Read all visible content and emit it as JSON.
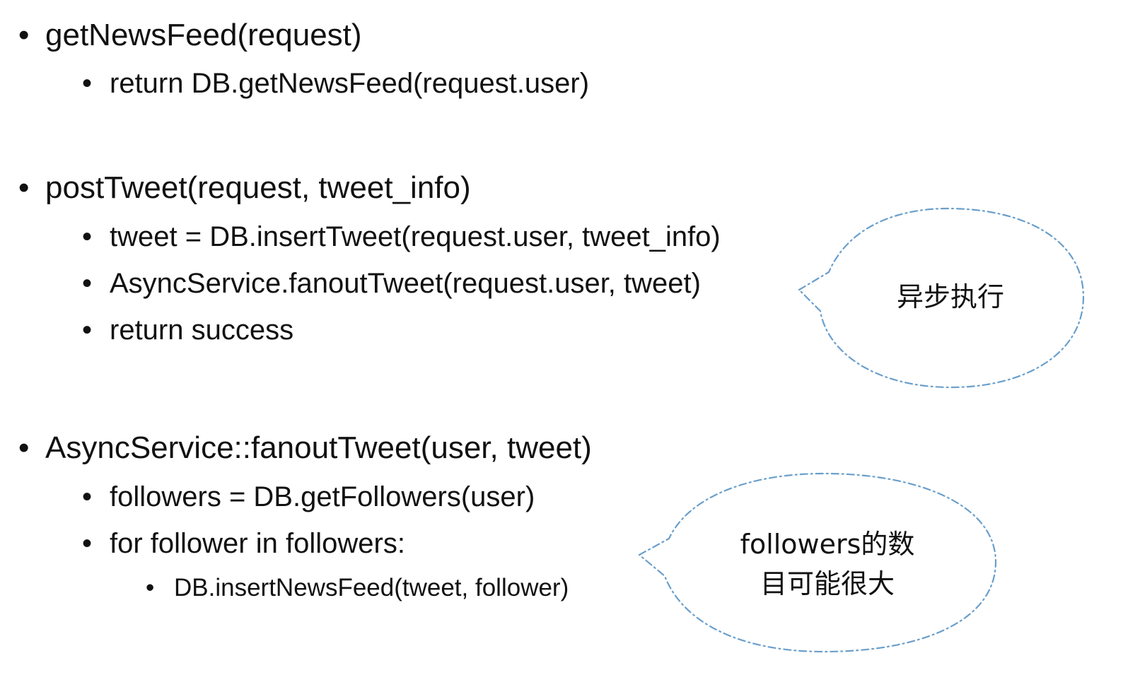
{
  "sections": [
    {
      "signature": "getNewsFeed(request)",
      "steps": [
        "return DB.getNewsFeed(request.user)"
      ]
    },
    {
      "signature": "postTweet(request, tweet_info)",
      "steps": [
        "tweet = DB.insertTweet(request.user, tweet_info)",
        "AsyncService.fanoutTweet(request.user, tweet)",
        "return success"
      ]
    },
    {
      "signature": "AsyncService::fanoutTweet(user, tweet)",
      "steps": [
        "followers = DB.getFollowers(user)",
        "for follower in followers:"
      ],
      "substeps": [
        "DB.insertNewsFeed(tweet, follower)"
      ]
    }
  ],
  "callouts": {
    "async": {
      "text": "异步执行"
    },
    "followers": {
      "line1": "followers的数",
      "line2": "目可能很大"
    }
  },
  "colors": {
    "text": "#111111",
    "callout_border": "#6a9fcb"
  },
  "bullet_glyph": "•"
}
